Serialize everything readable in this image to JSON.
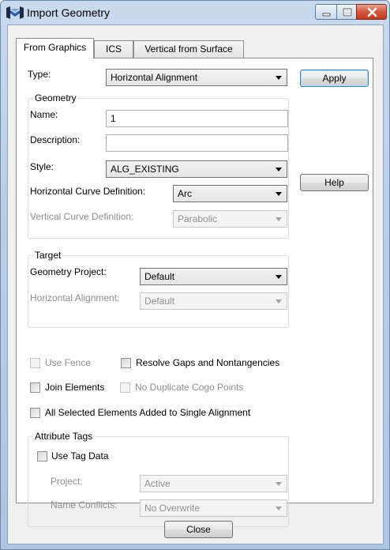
{
  "window": {
    "title": "Import Geometry",
    "icons": {
      "app": "bentley-app-icon",
      "minimize": "minimize-icon",
      "maximize": "maximize-icon",
      "close": "close-icon"
    }
  },
  "tabs": [
    {
      "label": "From Graphics",
      "active": true
    },
    {
      "label": "ICS",
      "active": false
    },
    {
      "label": "Vertical from Surface",
      "active": false
    }
  ],
  "form": {
    "type_label": "Type:",
    "type_value": "Horizontal Alignment",
    "geometry": {
      "legend": "Geometry",
      "name_label": "Name:",
      "name_value": "1",
      "description_label": "Description:",
      "description_value": "",
      "style_label": "Style:",
      "style_value": "ALG_EXISTING",
      "hcurve_label": "Horizontal Curve Definition:",
      "hcurve_value": "Arc",
      "vcurve_label": "Vertical Curve Definition:",
      "vcurve_value": "Parabolic"
    },
    "target": {
      "legend": "Target",
      "project_label": "Geometry Project:",
      "project_value": "Default",
      "halign_label": "Horizontal Alignment:",
      "halign_value": "Default"
    },
    "options": {
      "use_fence": {
        "label": "Use Fence",
        "checked": false,
        "enabled": false
      },
      "resolve_gaps": {
        "label": "Resolve Gaps and Nontangencies",
        "checked": false,
        "enabled": true
      },
      "join_elements": {
        "label": "Join Elements",
        "checked": false,
        "enabled": true
      },
      "no_duplicate": {
        "label": "No Duplicate Cogo Points",
        "checked": false,
        "enabled": false
      },
      "all_selected": {
        "label": "All Selected Elements Added to Single Alignment",
        "checked": false,
        "enabled": true
      }
    },
    "attribute_tags": {
      "legend": "Attribute Tags",
      "use_tag_label": "Use Tag Data",
      "project_label": "Project:",
      "project_value": "Active",
      "conflicts_label": "Name Conflicts:",
      "conflicts_value": "No Overwrite"
    }
  },
  "buttons": {
    "apply": "Apply",
    "help": "Help",
    "close": "Close"
  }
}
